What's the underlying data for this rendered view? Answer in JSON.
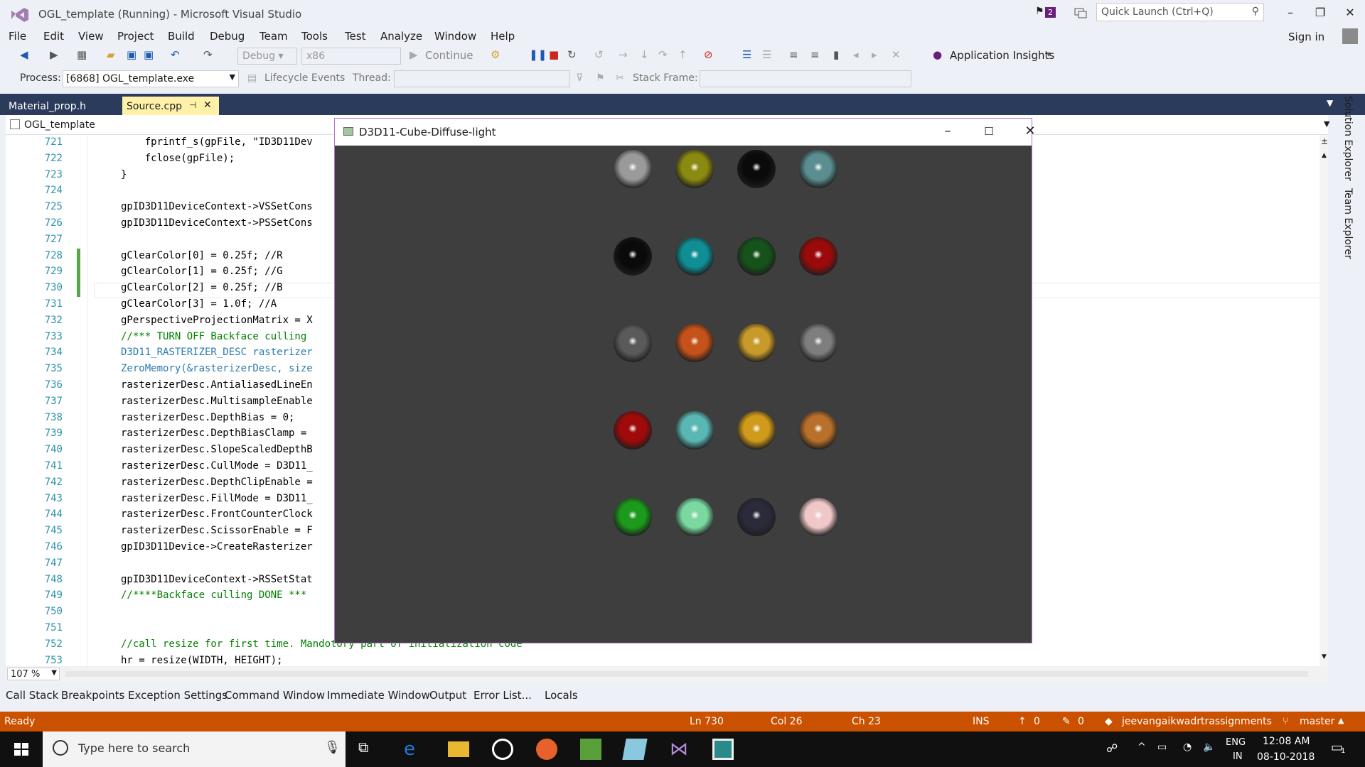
{
  "window": {
    "title": "OGL_template (Running) - Microsoft Visual Studio",
    "notification_count": "2"
  },
  "quick_launch": {
    "placeholder": "Quick Launch (Ctrl+Q)"
  },
  "menu": [
    "File",
    "Edit",
    "View",
    "Project",
    "Build",
    "Debug",
    "Team",
    "Tools",
    "Test",
    "Analyze",
    "Window",
    "Help"
  ],
  "sign_in": "Sign in",
  "toolbar": {
    "config": "Debug",
    "platform": "x86",
    "continue": "Continue",
    "insights": "Application Insights"
  },
  "process_bar": {
    "process_label": "Process:",
    "process_value": "[6868] OGL_template.exe",
    "lifecycle": "Lifecycle Events",
    "thread_label": "Thread:",
    "stack_label": "Stack Frame:"
  },
  "tabs": [
    {
      "label": "Material_prop.h"
    },
    {
      "label": "Source.cpp",
      "active": true
    }
  ],
  "navbar": {
    "project": "OGL_template"
  },
  "code_lines": [
    {
      "n": "721",
      "t": "    fprintf_s(gpFile, \"ID3D11Dev"
    },
    {
      "n": "722",
      "t": "    fclose(gpFile);"
    },
    {
      "n": "723",
      "t": "}"
    },
    {
      "n": "724",
      "t": ""
    },
    {
      "n": "725",
      "t": "gpID3D11DeviceContext->VSSetCons"
    },
    {
      "n": "726",
      "t": "gpID3D11DeviceContext->PSSetCons"
    },
    {
      "n": "727",
      "t": ""
    },
    {
      "n": "728",
      "t": "gClearColor[0] = 0.25f; //R"
    },
    {
      "n": "729",
      "t": "gClearColor[1] = 0.25f; //G"
    },
    {
      "n": "730",
      "t": "gClearColor[2] = 0.25f; //B"
    },
    {
      "n": "731",
      "t": "gClearColor[3] = 1.0f; //A"
    },
    {
      "n": "732",
      "t": "gPerspectiveProjectionMatrix = X"
    },
    {
      "n": "733",
      "t": "//*** TURN OFF Backface culling"
    },
    {
      "n": "734",
      "t": "D3D11_RASTERIZER_DESC rasterizer"
    },
    {
      "n": "735",
      "t": "ZeroMemory(&rasterizerDesc, size"
    },
    {
      "n": "736",
      "t": "rasterizerDesc.AntialiasedLineEn"
    },
    {
      "n": "737",
      "t": "rasterizerDesc.MultisampleEnable"
    },
    {
      "n": "738",
      "t": "rasterizerDesc.DepthBias = 0;"
    },
    {
      "n": "739",
      "t": "rasterizerDesc.DepthBiasClamp ="
    },
    {
      "n": "740",
      "t": "rasterizerDesc.SlopeScaledDepthB"
    },
    {
      "n": "741",
      "t": "rasterizerDesc.CullMode = D3D11_"
    },
    {
      "n": "742",
      "t": "rasterizerDesc.DepthClipEnable ="
    },
    {
      "n": "743",
      "t": "rasterizerDesc.FillMode = D3D11_"
    },
    {
      "n": "744",
      "t": "rasterizerDesc.FrontCounterClock"
    },
    {
      "n": "745",
      "t": "rasterizerDesc.ScissorEnable = F"
    },
    {
      "n": "746",
      "t": "gpID3D11Device->CreateRasterizer"
    },
    {
      "n": "747",
      "t": ""
    },
    {
      "n": "748",
      "t": "gpID3D11DeviceContext->RSSetStat"
    },
    {
      "n": "749",
      "t": "//****Backface culling DONE ***"
    },
    {
      "n": "750",
      "t": ""
    },
    {
      "n": "751",
      "t": ""
    },
    {
      "n": "752",
      "t": "//call resize for first time. Mandotory part of initialization code"
    },
    {
      "n": "753",
      "t": "hr = resize(WIDTH, HEIGHT);"
    }
  ],
  "side_panels": [
    "Solution Explorer",
    "Team Explorer"
  ],
  "zoom": "107 %",
  "bottom_tabs": [
    "Call Stack",
    "Breakpoints",
    "Exception Settings",
    "Command Window",
    "Immediate Window",
    "Output",
    "Error List...",
    "Locals"
  ],
  "status": {
    "ready": "Ready",
    "ln": "Ln 730",
    "col": "Col 26",
    "ch": "Ch 23",
    "ins": "INS",
    "up": "0",
    "pencil": "0",
    "repo": "jeevangaikwadrtrassignments",
    "branch": "master"
  },
  "d3d_window": {
    "title": "D3D11-Cube-Diffuse-light"
  },
  "spheres": [
    [
      "#9a9a9a",
      "#8b8a10",
      "#0a0a0a",
      "#5a8e90"
    ],
    [
      "#0a0a0a",
      "#0f8f94",
      "#16531a",
      "#9a0a0a"
    ],
    [
      "#5a5a5a",
      "#c5521a",
      "#c89a2a",
      "#7e7e7e"
    ],
    [
      "#a00a0a",
      "#5ab8b4",
      "#d09a1a",
      "#b8702a"
    ],
    [
      "#1b9a1b",
      "#7ad8a0",
      "#2a2a3a",
      "#f0c8c8"
    ]
  ],
  "taskbar": {
    "search_placeholder": "Type here to search",
    "lang": "ENG",
    "region": "IN",
    "time": "12:08 AM",
    "date": "08-10-2018",
    "notifications": "1"
  }
}
